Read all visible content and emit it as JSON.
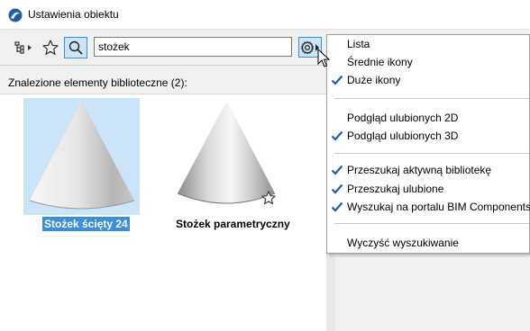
{
  "window": {
    "title": "Ustawienia obiektu"
  },
  "search": {
    "value": "stożek"
  },
  "results": {
    "header": "Znalezione elementy biblioteczne (2):",
    "items": [
      {
        "label": "Stożek ścięty 24",
        "selected": true
      },
      {
        "label": "Stożek parametryczny",
        "selected": false
      }
    ]
  },
  "menu": {
    "items": [
      {
        "label": "Lista",
        "checked": false
      },
      {
        "label": "Średnie ikony",
        "checked": false
      },
      {
        "label": "Duże ikony",
        "checked": true
      },
      {
        "label": "Podgląd ulubionych 2D",
        "checked": false
      },
      {
        "label": "Podgląd ulubionych 3D",
        "checked": true
      },
      {
        "label": "Przeszukaj aktywną bibliotekę",
        "checked": true
      },
      {
        "label": "Przeszukaj ulubione",
        "checked": true
      },
      {
        "label": "Wyszukaj na portalu BIM Components",
        "checked": true
      },
      {
        "label": "Wyczyść wyszukiwanie",
        "checked": false
      }
    ]
  },
  "colors": {
    "accent": "#3b8fd9",
    "selection_bg": "#cce4f7",
    "check": "#1e5fa8"
  },
  "icons": [
    "app-icon",
    "tree-icon",
    "star-icon",
    "search-icon",
    "gear-icon",
    "checkmark-icon",
    "cursor-icon"
  ]
}
